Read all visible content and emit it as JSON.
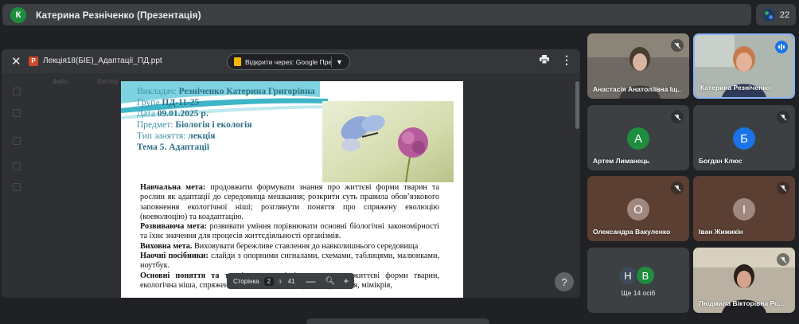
{
  "topbar": {
    "avatar_letter": "К",
    "title": "Катерина Резніченко (Презентація)"
  },
  "people_chip": {
    "count": "22"
  },
  "presentation": {
    "filename": "Лекція18(БІЕ)_Адаптації_ПД.ppt",
    "file_icon": "P",
    "open_with_label": "Відкрити через: Google Пре...",
    "ghost_tabs": [
      "Файл",
      "Вигляд"
    ]
  },
  "slide": {
    "info": {
      "lecturer_label": "Викладач:",
      "lecturer": "Резніченко Катерина Григорівна",
      "group_label": "Група",
      "group": "ПД-11-25",
      "date_label": "Дата",
      "date": "09.01.2025 р.",
      "subject_label": "Предмет:",
      "subject": "Біологія і екологія",
      "type_label": "Тип заняття:",
      "type": "лекція",
      "topic": "Тема 5.   Адаптації"
    },
    "body": {
      "p1_bold": "Навчальна мета:",
      "p1": " продовжити формувати знання про життєві форми тварин та рослин як адаптації до середовища мешкання; розкрити суть правила обов’язкового заповнення екологічної ніші; розглянути поняття про спряжену еволюцію (коеволюцію) та коадаптацію.",
      "p2_bold": "Розвиваюча мета:",
      "p2": " розвивати уміння порівнювати основні біологічні закономірності та їхнє значення для процесів життєдіяльності організмів.",
      "p3_bold": "Виховна мета.",
      "p3": " Виховувати бережливе ставлення до навколишнього середовища",
      "p4_bold": "Наочні посібники:",
      "p4": " слайди з опорними сигналами, схемами, таблицями, малюнками, ноутбук.",
      "p5_bold": "Основні поняття та т",
      "p5": "ерміни: життєві форми рослин, життєві форми тварин, екологічна ніша, спряжена еволюція (коеволюція), коадаптація, мімікрія,"
    }
  },
  "slide_nav": {
    "label": "Сторінка",
    "page": "2",
    "of": "з",
    "total": "41"
  },
  "participants": [
    {
      "name": "Анастасія Анатоліївна Іщ...",
      "mic": "muted"
    },
    {
      "name": "Катерина Резніченко",
      "mic": "speaking"
    },
    {
      "name": "Артем Лиманець",
      "letter": "А",
      "color": "#1e8e3e",
      "mic": "muted"
    },
    {
      "name": "Богдан Клюс",
      "letter": "Б",
      "color": "#1a73e8",
      "mic": "muted"
    },
    {
      "name": "Олександра Вакуленко",
      "letter": "О",
      "color": "#a1887f",
      "mic": "muted"
    },
    {
      "name": "Іван Жижикін",
      "letter": "І",
      "color": "#a1887f",
      "mic": "muted"
    },
    {
      "more_label": "Ще 14 осіб",
      "letters": [
        "Н",
        "В"
      ],
      "colors": [
        "#3c4a5a",
        "#1e8e3e"
      ]
    },
    {
      "name": "Людмила Вікторівна Ро...",
      "mic": "muted"
    }
  ]
}
